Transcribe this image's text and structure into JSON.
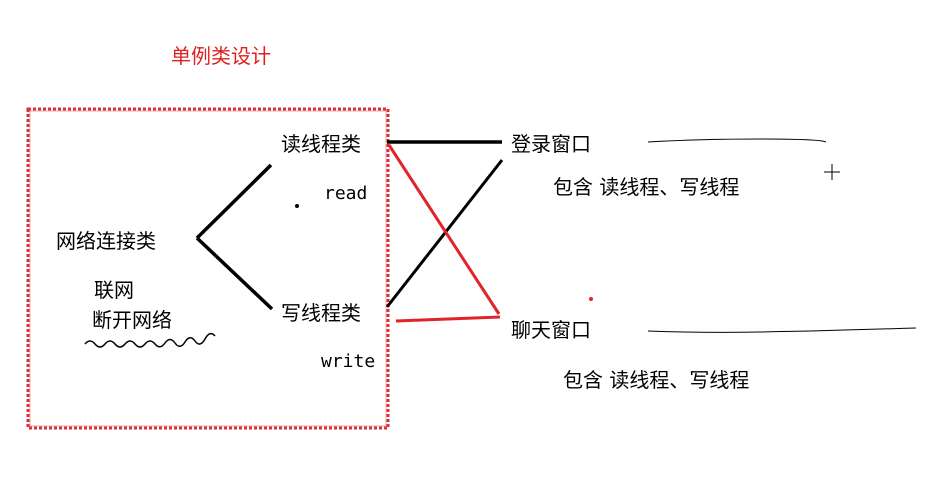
{
  "title": "单例类设计",
  "network_class": {
    "label": "网络连接类",
    "duties": [
      "联网",
      "断开网络"
    ]
  },
  "read_thread": {
    "label": "读线程类",
    "method": "read"
  },
  "write_thread": {
    "label": "写线程类",
    "method": "write"
  },
  "login_window": {
    "label": "登录窗口",
    "contains": "包含 读线程、写线程"
  },
  "chat_window": {
    "label": "聊天窗口",
    "contains": "包含 读线程、写线程"
  },
  "colors": {
    "black_line": "#000000",
    "red_line": "#e0242a",
    "box_border": "#d9303a"
  }
}
